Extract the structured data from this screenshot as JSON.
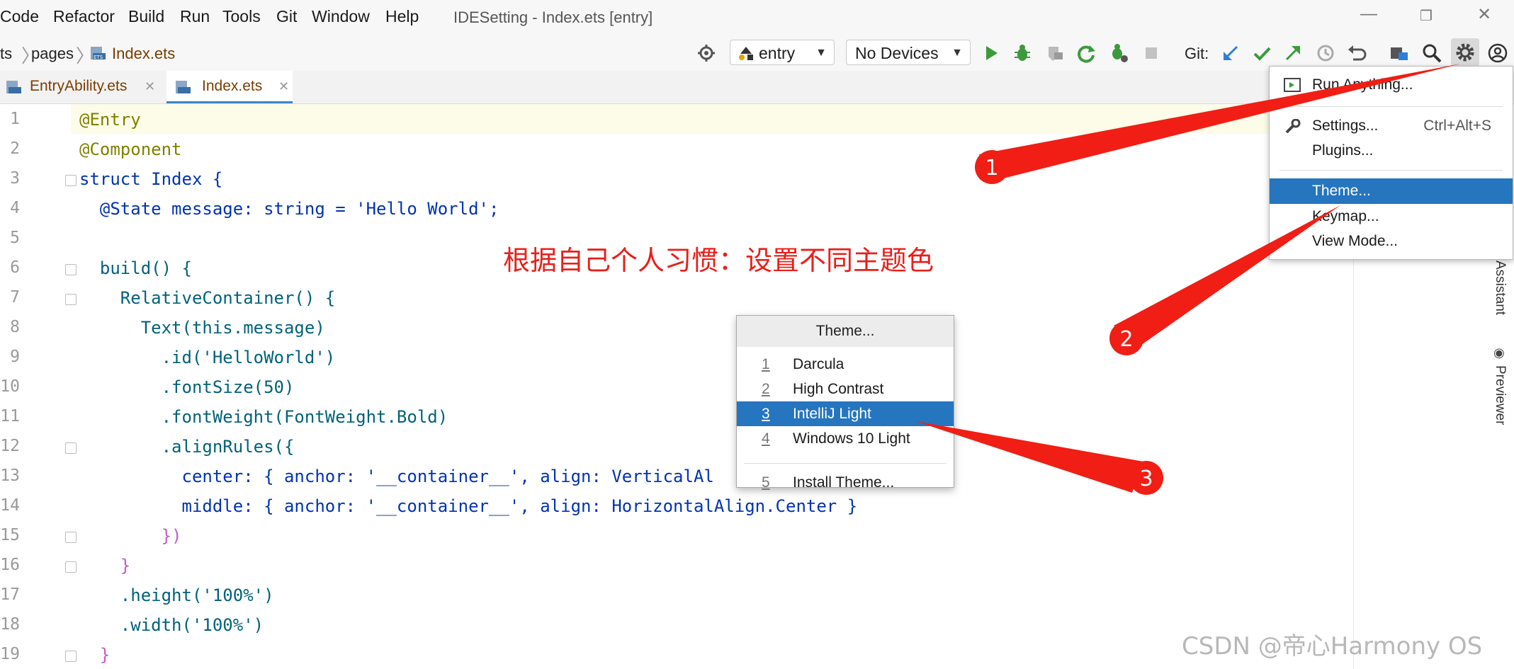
{
  "menu": {
    "items": [
      "Code",
      "Refactor",
      "Build",
      "Run",
      "Tools",
      "Git",
      "Window",
      "Help"
    ],
    "window_title": "IDESetting - Index.ets [entry]",
    "controls": {
      "minimize": "—",
      "restore": "❐",
      "close": "✕"
    }
  },
  "navbar": {
    "breadcrumbs": [
      "ts",
      "pages",
      "Index.ets"
    ],
    "module_combo": "entry",
    "device_combo": "No Devices",
    "git_label": "Git:"
  },
  "toolbar_icons": [
    "target-icon",
    "run-icon",
    "debug-icon",
    "attach-icon",
    "rerun-icon",
    "profile-icon",
    "stop-icon",
    "git-update-icon",
    "git-commit-icon",
    "git-push-icon",
    "history-icon",
    "rollback-icon",
    "project-structure-icon",
    "search-icon",
    "settings-gear-icon",
    "account-icon"
  ],
  "tabs": [
    {
      "label": "EntryAbility.ets",
      "active": false
    },
    {
      "label": "Index.ets",
      "active": true
    }
  ],
  "editor": {
    "line_numbers": [
      "1",
      "2",
      "3",
      "4",
      "5",
      "6",
      "7",
      "8",
      "9",
      "10",
      "11",
      "12",
      "13",
      "14",
      "15",
      "16",
      "17",
      "18",
      "19"
    ],
    "lines": [
      "@Entry",
      "@Component",
      "struct Index {",
      "  @State message: string = 'Hello World';",
      "",
      "  build() {",
      "    RelativeContainer() {",
      "      Text(this.message)",
      "        .id('HelloWorld')",
      "        .fontSize(50)",
      "        .fontWeight(FontWeight.Bold)",
      "        .alignRules({",
      "          center: { anchor: '__container__', align: VerticalAl",
      "          middle: { anchor: '__container__', align: HorizontalAlign.Center }",
      "        })",
      "    }",
      "    .height('100%')",
      "    .width('100%')",
      "  }"
    ]
  },
  "annotation_text": "根据自己个人习惯：设置不同主题色",
  "dropdown": {
    "items": [
      {
        "label": "Run Anything...",
        "shortcut": ""
      },
      {
        "label": "Settings...",
        "shortcut": "Ctrl+Alt+S"
      },
      {
        "label": "Plugins...",
        "shortcut": ""
      },
      {
        "label": "Theme...",
        "shortcut": "",
        "selected": true
      },
      {
        "label": "Keymap...",
        "shortcut": ""
      },
      {
        "label": "View Mode...",
        "shortcut": ""
      }
    ]
  },
  "theme_popup": {
    "title": "Theme...",
    "items": [
      {
        "num": "1",
        "label": "Darcula"
      },
      {
        "num": "2",
        "label": "High Contrast"
      },
      {
        "num": "3",
        "label": "IntelliJ Light",
        "selected": true
      },
      {
        "num": "4",
        "label": "Windows 10 Light"
      },
      {
        "num": "5",
        "label": "Install Theme..."
      }
    ]
  },
  "right_sidebar": {
    "assistant": "Assistant",
    "previewer": "Previewer"
  },
  "callouts": [
    "1",
    "2",
    "3"
  ],
  "watermark": "CSDN @帝心Harmony OS",
  "colors": {
    "accent": "#2675bf",
    "annotation": "#e8201a",
    "run_green": "#3c9a3c"
  }
}
